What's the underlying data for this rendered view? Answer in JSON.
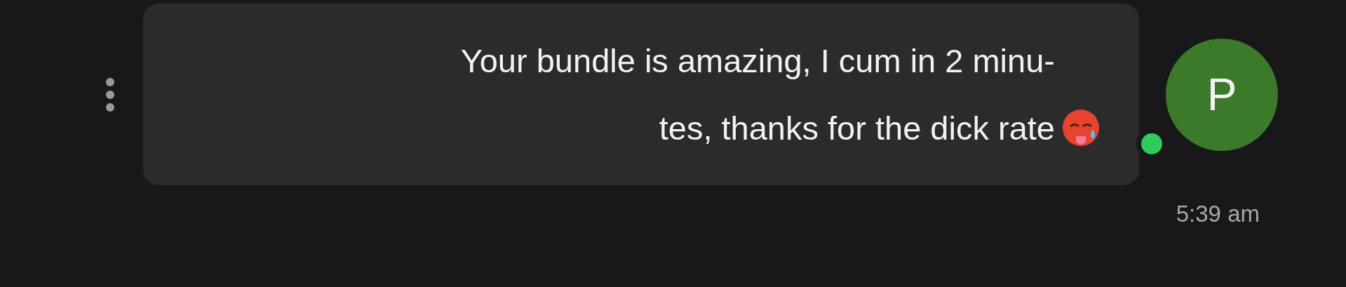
{
  "message": {
    "lines": [
      "Your bundle is amazing, I cum in 2 minu-",
      "tes, thanks for the dick rate"
    ],
    "time": "5:39 am",
    "sender": {
      "initial": "P",
      "online": true
    }
  }
}
